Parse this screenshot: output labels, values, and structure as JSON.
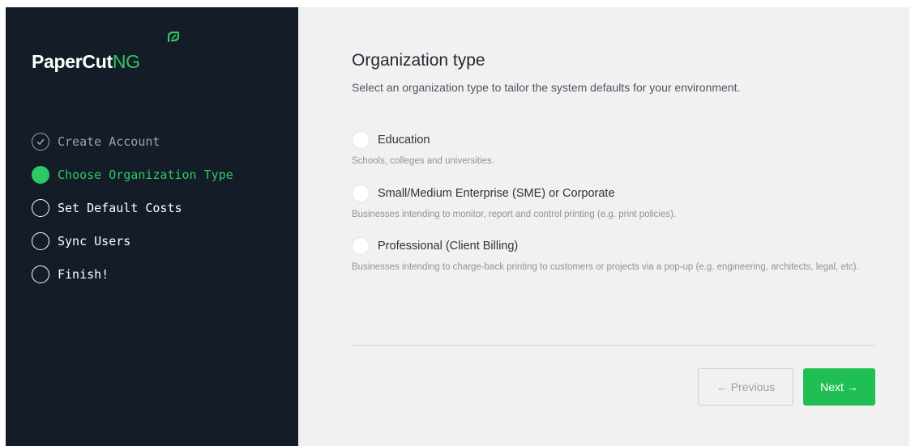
{
  "brand": {
    "name_part1": "PaperCut",
    "name_part2": "NG",
    "accent_color": "#2ec866",
    "leaf_icon": "leaf-icon"
  },
  "steps": [
    {
      "label": "Create Account",
      "state": "done",
      "icon": "check-circle-icon"
    },
    {
      "label": "Choose Organization Type",
      "state": "active",
      "icon": "filled-circle-icon"
    },
    {
      "label": "Set Default Costs",
      "state": "todo",
      "icon": "empty-circle-icon"
    },
    {
      "label": "Sync Users",
      "state": "todo",
      "icon": "empty-circle-icon"
    },
    {
      "label": "Finish!",
      "state": "todo",
      "icon": "empty-circle-icon"
    }
  ],
  "main": {
    "title": "Organization type",
    "subtitle": "Select an organization type to tailor the system defaults for your environment.",
    "options": [
      {
        "label": "Education",
        "description": "Schools, colleges and universities.",
        "selected": false
      },
      {
        "label": "Small/Medium Enterprise (SME) or Corporate",
        "description": "Businesses intending to monitor, report and control printing (e.g. print policies).",
        "selected": false
      },
      {
        "label": "Professional (Client Billing)",
        "description": "Businesses intending to charge-back printing to customers or projects via a pop-up (e.g. engineering, architects, legal, etc).",
        "selected": false
      }
    ]
  },
  "footer": {
    "previous_label": "← Previous",
    "next_label": "Next →",
    "next_color": "#20bf55"
  }
}
